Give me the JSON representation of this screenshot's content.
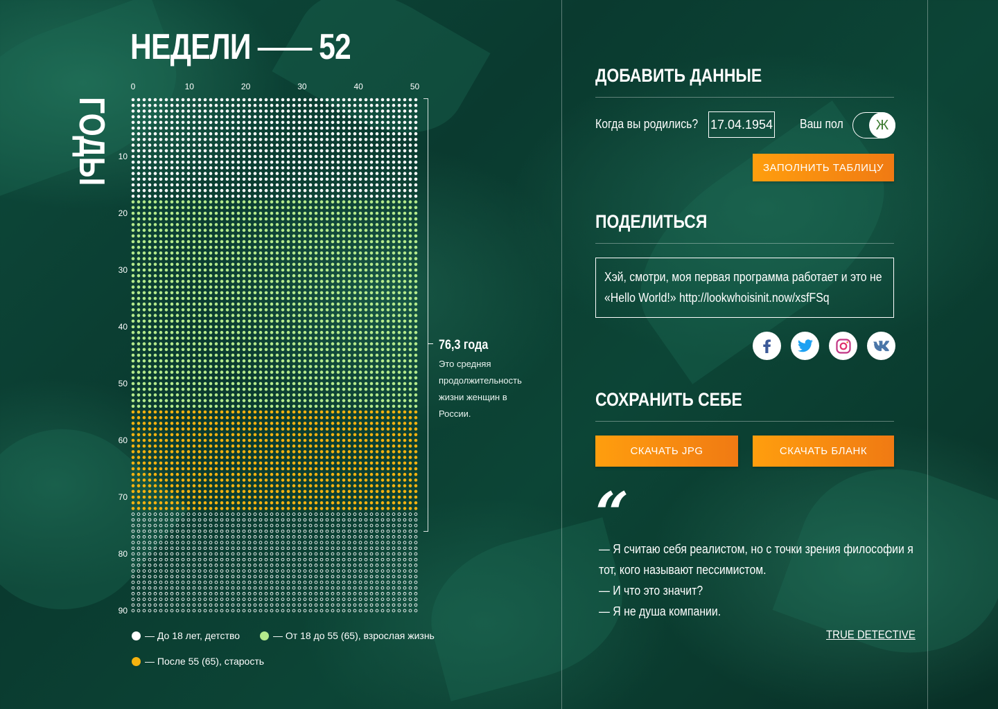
{
  "header": {
    "weeks_label": "НЕДЕЛИ",
    "weeks_count": "52",
    "years_label": "ГОДЫ"
  },
  "grid": {
    "x_ticks": [
      "0",
      "10",
      "20",
      "30",
      "40",
      "50"
    ],
    "y_ticks": [
      "10",
      "20",
      "30",
      "40",
      "50",
      "60",
      "70",
      "80",
      "90"
    ],
    "weeks_per_year": 52,
    "total_years": 91,
    "lived_years": 73,
    "childhood_until": 18,
    "adult_until": 55,
    "colors": {
      "childhood": "#ffffff",
      "adult": "#b4ea8c",
      "old_age": "#f5b20f"
    }
  },
  "lifespan": {
    "value": "76,3 года",
    "description": "Это средняя продолжительность жизни женщин в России."
  },
  "legend": [
    {
      "label": "— До 18 лет, детство",
      "color": "#ffffff"
    },
    {
      "label": "— От 18 до 55 (65), взрослая жизнь",
      "color": "#b4ea8c"
    },
    {
      "label": "— После 55 (65), старость",
      "color": "#f5b20f"
    }
  ],
  "add_data": {
    "title": "ДОБАВИТЬ ДАННЫЕ",
    "birth_label": "Когда вы родились?",
    "birth_value": "17.04.1954",
    "gender_label": "Ваш пол",
    "gender_value": "Ж",
    "fill_button": "ЗАПОЛНИТЬ ТАБЛИЦУ"
  },
  "share": {
    "title": "ПОДЕЛИТЬСЯ",
    "text_line1": "Хэй, смотри, моя первая программа работает и это не",
    "text_line2": "«Hello World!» http://lookwhoisinit.now/xsfFSq",
    "networks": [
      "facebook-icon",
      "twitter-icon",
      "instagram-icon",
      "vk-icon"
    ]
  },
  "save": {
    "title": "СОХРАНИТЬ СЕБЕ",
    "jpg_button": "СКАЧАТЬ JPG",
    "blank_button": "СКАЧАТЬ БЛАНК"
  },
  "quote": {
    "mark": "“",
    "lines": [
      "— Я считаю себя реалистом, но с точки зрения философии я",
      "тот, кого называют пессимистом.",
      "— И что это значит?",
      "— Я не душа компании."
    ],
    "source": "TRUE DETECTIVE"
  }
}
